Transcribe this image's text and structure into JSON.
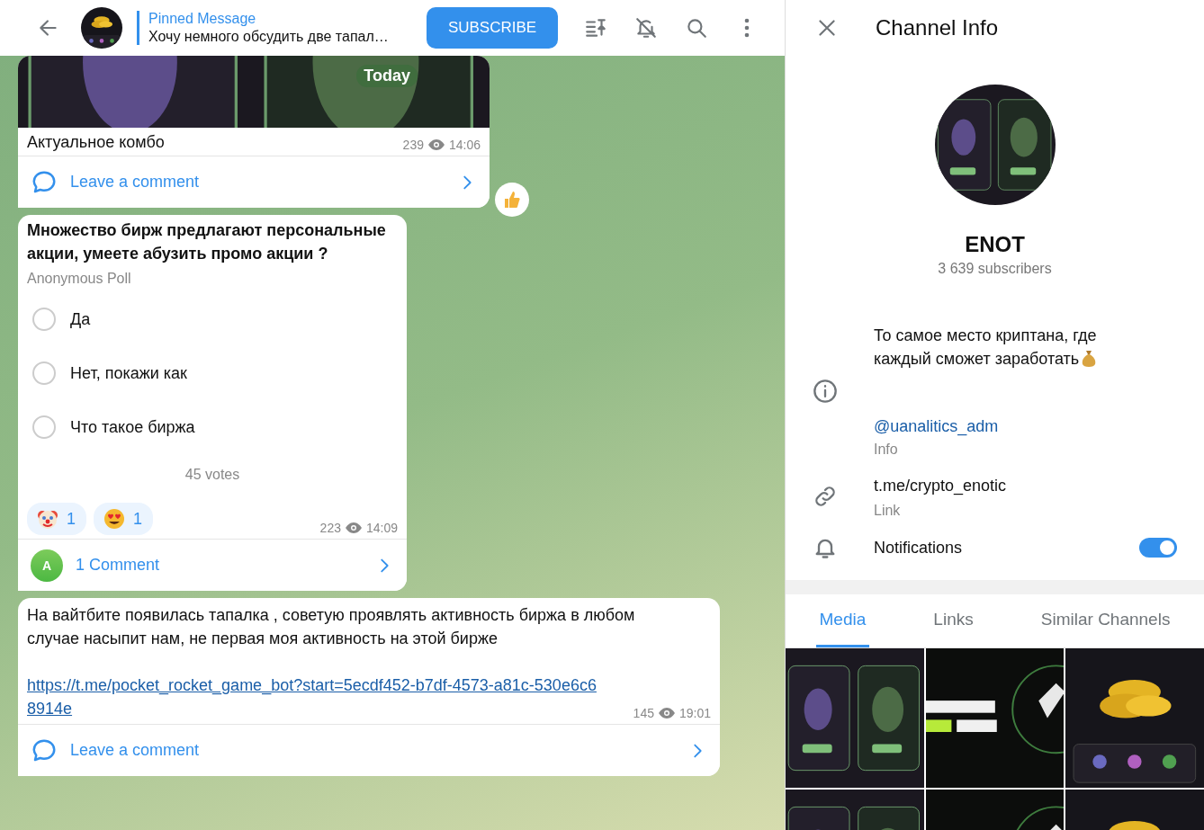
{
  "header": {
    "pinned_label": "Pinned Message",
    "pinned_text": "Хочу немного обсудить две тапал…",
    "subscribe": "SUBSCRIBE"
  },
  "messages": [
    {
      "date_badge": "Today",
      "caption": "Актуальное комбо",
      "views": "239",
      "time": "14:06",
      "comment": "Leave a comment",
      "side_reaction": {
        "kind": "thumbs-up"
      }
    },
    {
      "kind": "poll",
      "question": "Множество бирж предлагают персональные акции, умеете абузить промо акции ?",
      "poll_type": "Anonymous Poll",
      "options": [
        {
          "label": "Да",
          "selected": false
        },
        {
          "label": "Нет, покажи как",
          "selected": false
        },
        {
          "label": "Что такое биржа",
          "selected": false
        }
      ],
      "votes": "45 votes",
      "reactions": [
        {
          "kind": "clown",
          "count": "1"
        },
        {
          "kind": "heart-eyes",
          "count": "1"
        }
      ],
      "views": "223",
      "time": "14:09",
      "comment": "1 Comment",
      "commenter_initial": "A"
    },
    {
      "kind": "text",
      "text": "На вайтбите появилась тапалка , советую проявлять активность биржа в любом случае насыпит нам, не первая моя активность на этой бирже",
      "link": "https://t.me/pocket_rocket_game_bot?start=5ecdf452-b7df-4573-a81c-530e6c68914e",
      "views": "145",
      "time": "19:01",
      "comment": "Leave a comment"
    }
  ],
  "info": {
    "title": "Channel Info",
    "name": "ENOT",
    "subscribers": "3 639 subscribers",
    "description": "То самое место криптана, где каждый сможет заработать",
    "username": "@uanalitics_adm",
    "username_label": "Info",
    "link": "t.me/crypto_enotic",
    "link_label": "Link",
    "notifications": {
      "label": "Notifications",
      "on": true
    }
  },
  "tabs": [
    {
      "label": "Media",
      "selected": true
    },
    {
      "label": "Links",
      "selected": false
    },
    {
      "label": "Similar Channels",
      "selected": false
    }
  ]
}
